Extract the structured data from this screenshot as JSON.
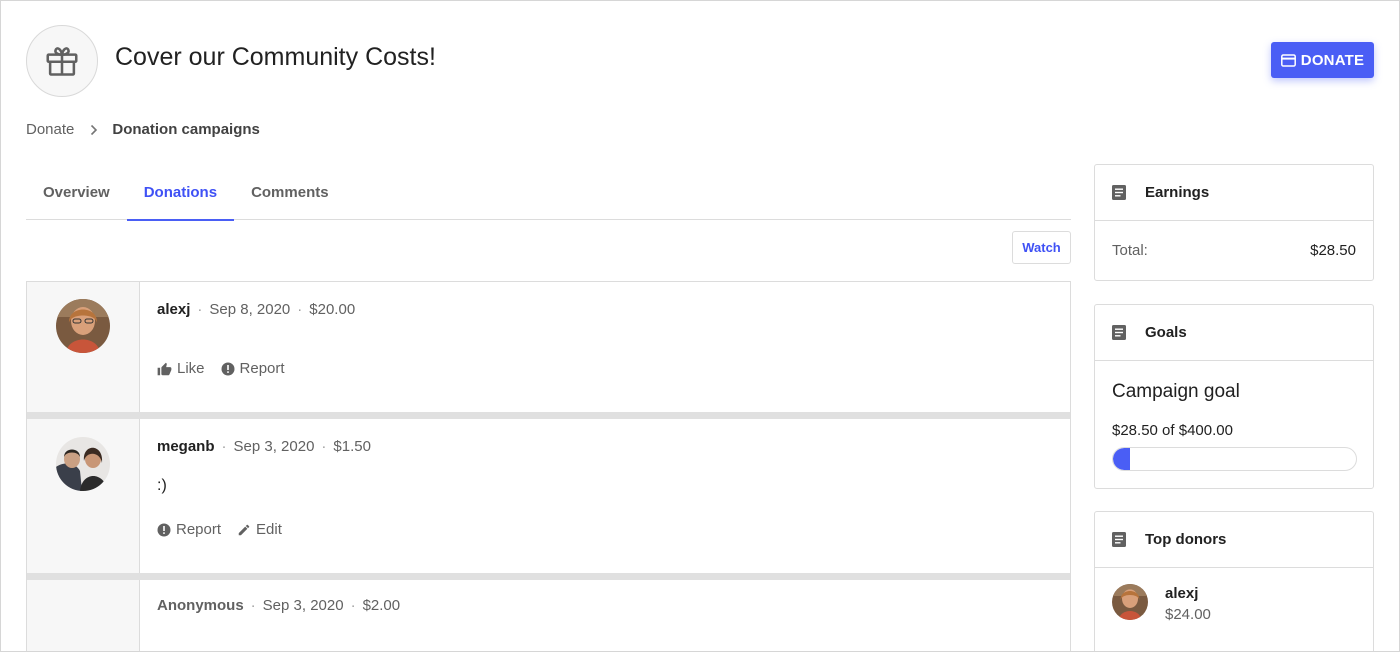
{
  "header": {
    "title": "Cover our Community Costs!",
    "icon": "gift-icon",
    "donate_label": "DONATE",
    "accent_color": "#4a5ef5"
  },
  "breadcrumb": {
    "items": [
      "Donate",
      "Donation campaigns"
    ]
  },
  "tabs": [
    {
      "label": "Overview",
      "active": false
    },
    {
      "label": "Donations",
      "active": true
    },
    {
      "label": "Comments",
      "active": false
    }
  ],
  "watch_label": "Watch",
  "donations": [
    {
      "user": "alexj",
      "date": "Sep 8, 2020",
      "amount": "$20.00",
      "message": "",
      "actions": [
        "Like",
        "Report"
      ]
    },
    {
      "user": "meganb",
      "date": "Sep 3, 2020",
      "amount": "$1.50",
      "message": ":)",
      "actions": [
        "Report",
        "Edit"
      ]
    },
    {
      "user": "Anonymous",
      "date": "Sep 3, 2020",
      "amount": "$2.00",
      "message": "",
      "actions": []
    }
  ],
  "sidebar": {
    "earnings": {
      "title": "Earnings",
      "total_label": "Total:",
      "total_value": "$28.50"
    },
    "goals": {
      "title": "Goals",
      "goal_title": "Campaign goal",
      "goal_text": "$28.50 of $400.00",
      "progress_fraction": 0.07125
    },
    "top_donors": {
      "title": "Top donors",
      "items": [
        {
          "user": "alexj",
          "amount": "$24.00"
        }
      ]
    }
  }
}
